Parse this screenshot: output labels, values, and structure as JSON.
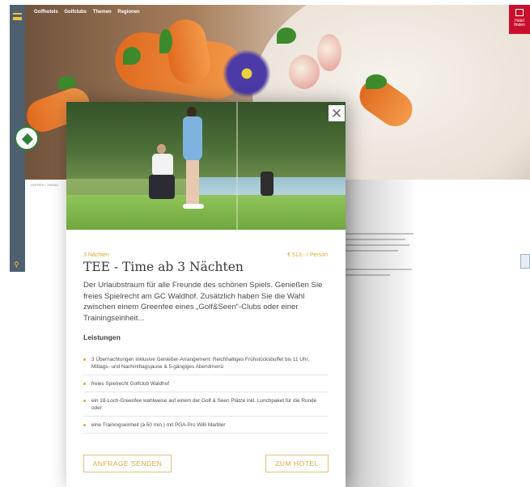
{
  "background": {
    "nav_items": [
      "Golfhotels",
      "Golfclubs",
      "Themen",
      "Regionen"
    ],
    "hotel_button_label": "Hotel finden",
    "breadcrumb": "UNTREN / THEMA"
  },
  "modal": {
    "nights_label": "3 Nächten",
    "price_label": "€ 513,- / Person",
    "title": "TEE - Time ab 3 Nächten",
    "description": "Der Urlaubstraum für alle Freunde des schönen Spiels. Genießen Sie freies Spielrecht am GC Waldhof. Zusätzlich haben Sie die Wahl zwischen einem Greenfee eines „Golf&Seen“-Clubs oder einer Trainingseinheit...",
    "services_title": "Leistungen",
    "services": [
      "3 Übernachtungen inklusive Genießer-Arrangement: Reichhaltiges Frühstücksbuffet bis 11 Uhr, Mittags- und Nachmittagsjause & 5-gängiges Abendmenü",
      "freies Spielrecht Golfclub Waldhof",
      "ein 18-Loch-Greenfee wahlweise auf einem der Golf & Seen Plätze inkl. Lunchpaket für die Runde oder",
      "eine Trainingseinheit (à 50 min.) mit PGA-Pro Willi Marbler"
    ],
    "inquiry_button": "ANFRAGE SENDEN",
    "hotel_button": "ZUM HOTEL",
    "close_symbol": "✕"
  },
  "colors": {
    "accent_gold": "#d9a93b",
    "sidebar": "#4e6070",
    "hotel_red": "#c8102e"
  },
  "icons": {
    "menu": "hamburger-menu-icon",
    "search": "search-icon",
    "close": "close-icon",
    "hotel": "hotel-house-icon",
    "bullet": "bullet-dot-icon"
  }
}
